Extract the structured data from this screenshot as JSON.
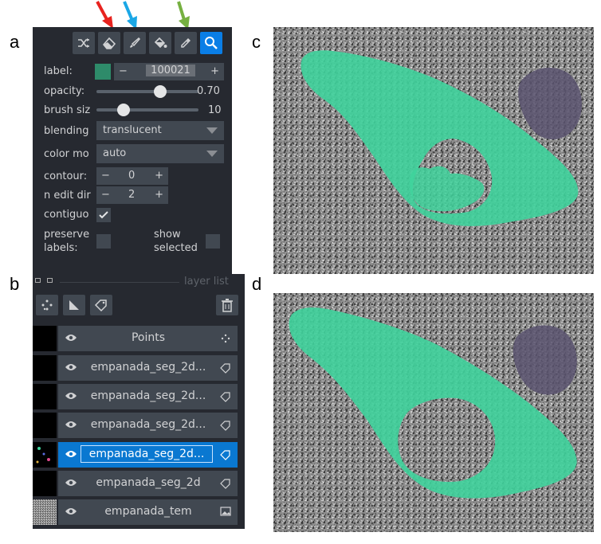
{
  "panel_labels": {
    "a": "a",
    "b": "b",
    "c": "c",
    "d": "d"
  },
  "arrows": {
    "eraser": "#e8231f",
    "paintbrush": "#1aa7e6",
    "picker": "#76b041"
  },
  "toolbar": {
    "icons": [
      "shuffle-icon",
      "eraser-icon",
      "paintbrush-icon",
      "fill-bucket-icon",
      "color-picker-icon",
      "zoom-icon"
    ]
  },
  "layer_controls": {
    "label": {
      "name": "label:",
      "value": "100021",
      "color": "#2e8b6a"
    },
    "opacity": {
      "name": "opacity:",
      "value": "0.70",
      "level": 0.7
    },
    "brush_size": {
      "name": "brush siz",
      "value": "10",
      "level": 0.25
    },
    "blending": {
      "name": "blending",
      "value": "translucent"
    },
    "color_mode": {
      "name": "color mo",
      "value": "auto"
    },
    "contour": {
      "name": "contour:",
      "value": "0"
    },
    "n_edit_dim": {
      "name": "n edit dir",
      "value": "2"
    },
    "contiguous": {
      "name": "contiguo",
      "checked": true
    },
    "preserve_labels": {
      "name_line1": "preserve",
      "name_line2": "labels:",
      "checked": false
    },
    "show_selected": {
      "name_line1": "show",
      "name_line2": "selected",
      "checked": false
    }
  },
  "layer_list": {
    "title": "layer list",
    "layers": [
      {
        "name": "Points",
        "type": "points",
        "selected": false
      },
      {
        "name": "empanada_seg_2d...",
        "type": "labels",
        "selected": false
      },
      {
        "name": "empanada_seg_2d...",
        "type": "labels",
        "selected": false
      },
      {
        "name": "empanada_seg_2d...",
        "type": "labels",
        "selected": false
      },
      {
        "name": "empanada_seg_2d...",
        "type": "labels",
        "selected": true
      },
      {
        "name": "empanada_seg_2d",
        "type": "labels",
        "selected": false
      },
      {
        "name": "empanada_tem",
        "type": "image",
        "selected": false
      }
    ]
  },
  "colors": {
    "segment_green": "#3fd39c",
    "segment_purple": "#5b5470",
    "selected_layer": "#0a78d1"
  }
}
